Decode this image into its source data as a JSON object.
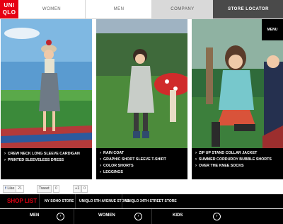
{
  "logo": {
    "line1": "UNI",
    "line2": "QLO"
  },
  "nav": {
    "women": "WOMEN",
    "men": "MEN",
    "company": "COMPANY",
    "store_locator": "STORE LOCATOR"
  },
  "menu_button": "MENU",
  "panels": [
    {
      "items": [
        "CREW NECK LONG SLEEVE CARDIGAN",
        "PRINTED SLEEVELESS DRESS"
      ]
    },
    {
      "items": [
        "RAIN COAT",
        "GRAPHIC SHORT SLEEVE T-SHIRT",
        "COLOR SHORTS",
        "LEGGINGS"
      ]
    },
    {
      "items": [
        "ZIP UP STAND COLLAR JACKET",
        "SUMMER CORDUROY BUBBLE SHORTS",
        "OVER THE KNEE SOCKS"
      ]
    }
  ],
  "social": {
    "like": "Like",
    "like_count": "21",
    "tweet": "Tweet",
    "tweet_count": "0",
    "gplus": "+1",
    "gplus_count": "0"
  },
  "shop_list": {
    "title": "SHOP LIST",
    "stores": [
      "NY SOHO STORE",
      "UNIQLO 5TH AVENUE STORE",
      "UNIQLO 34TH STREET STORE"
    ]
  },
  "categories": [
    "MEN",
    "WOMEN",
    "KIDS"
  ],
  "colors": {
    "brand_red": "#e60012",
    "black": "#000000"
  }
}
